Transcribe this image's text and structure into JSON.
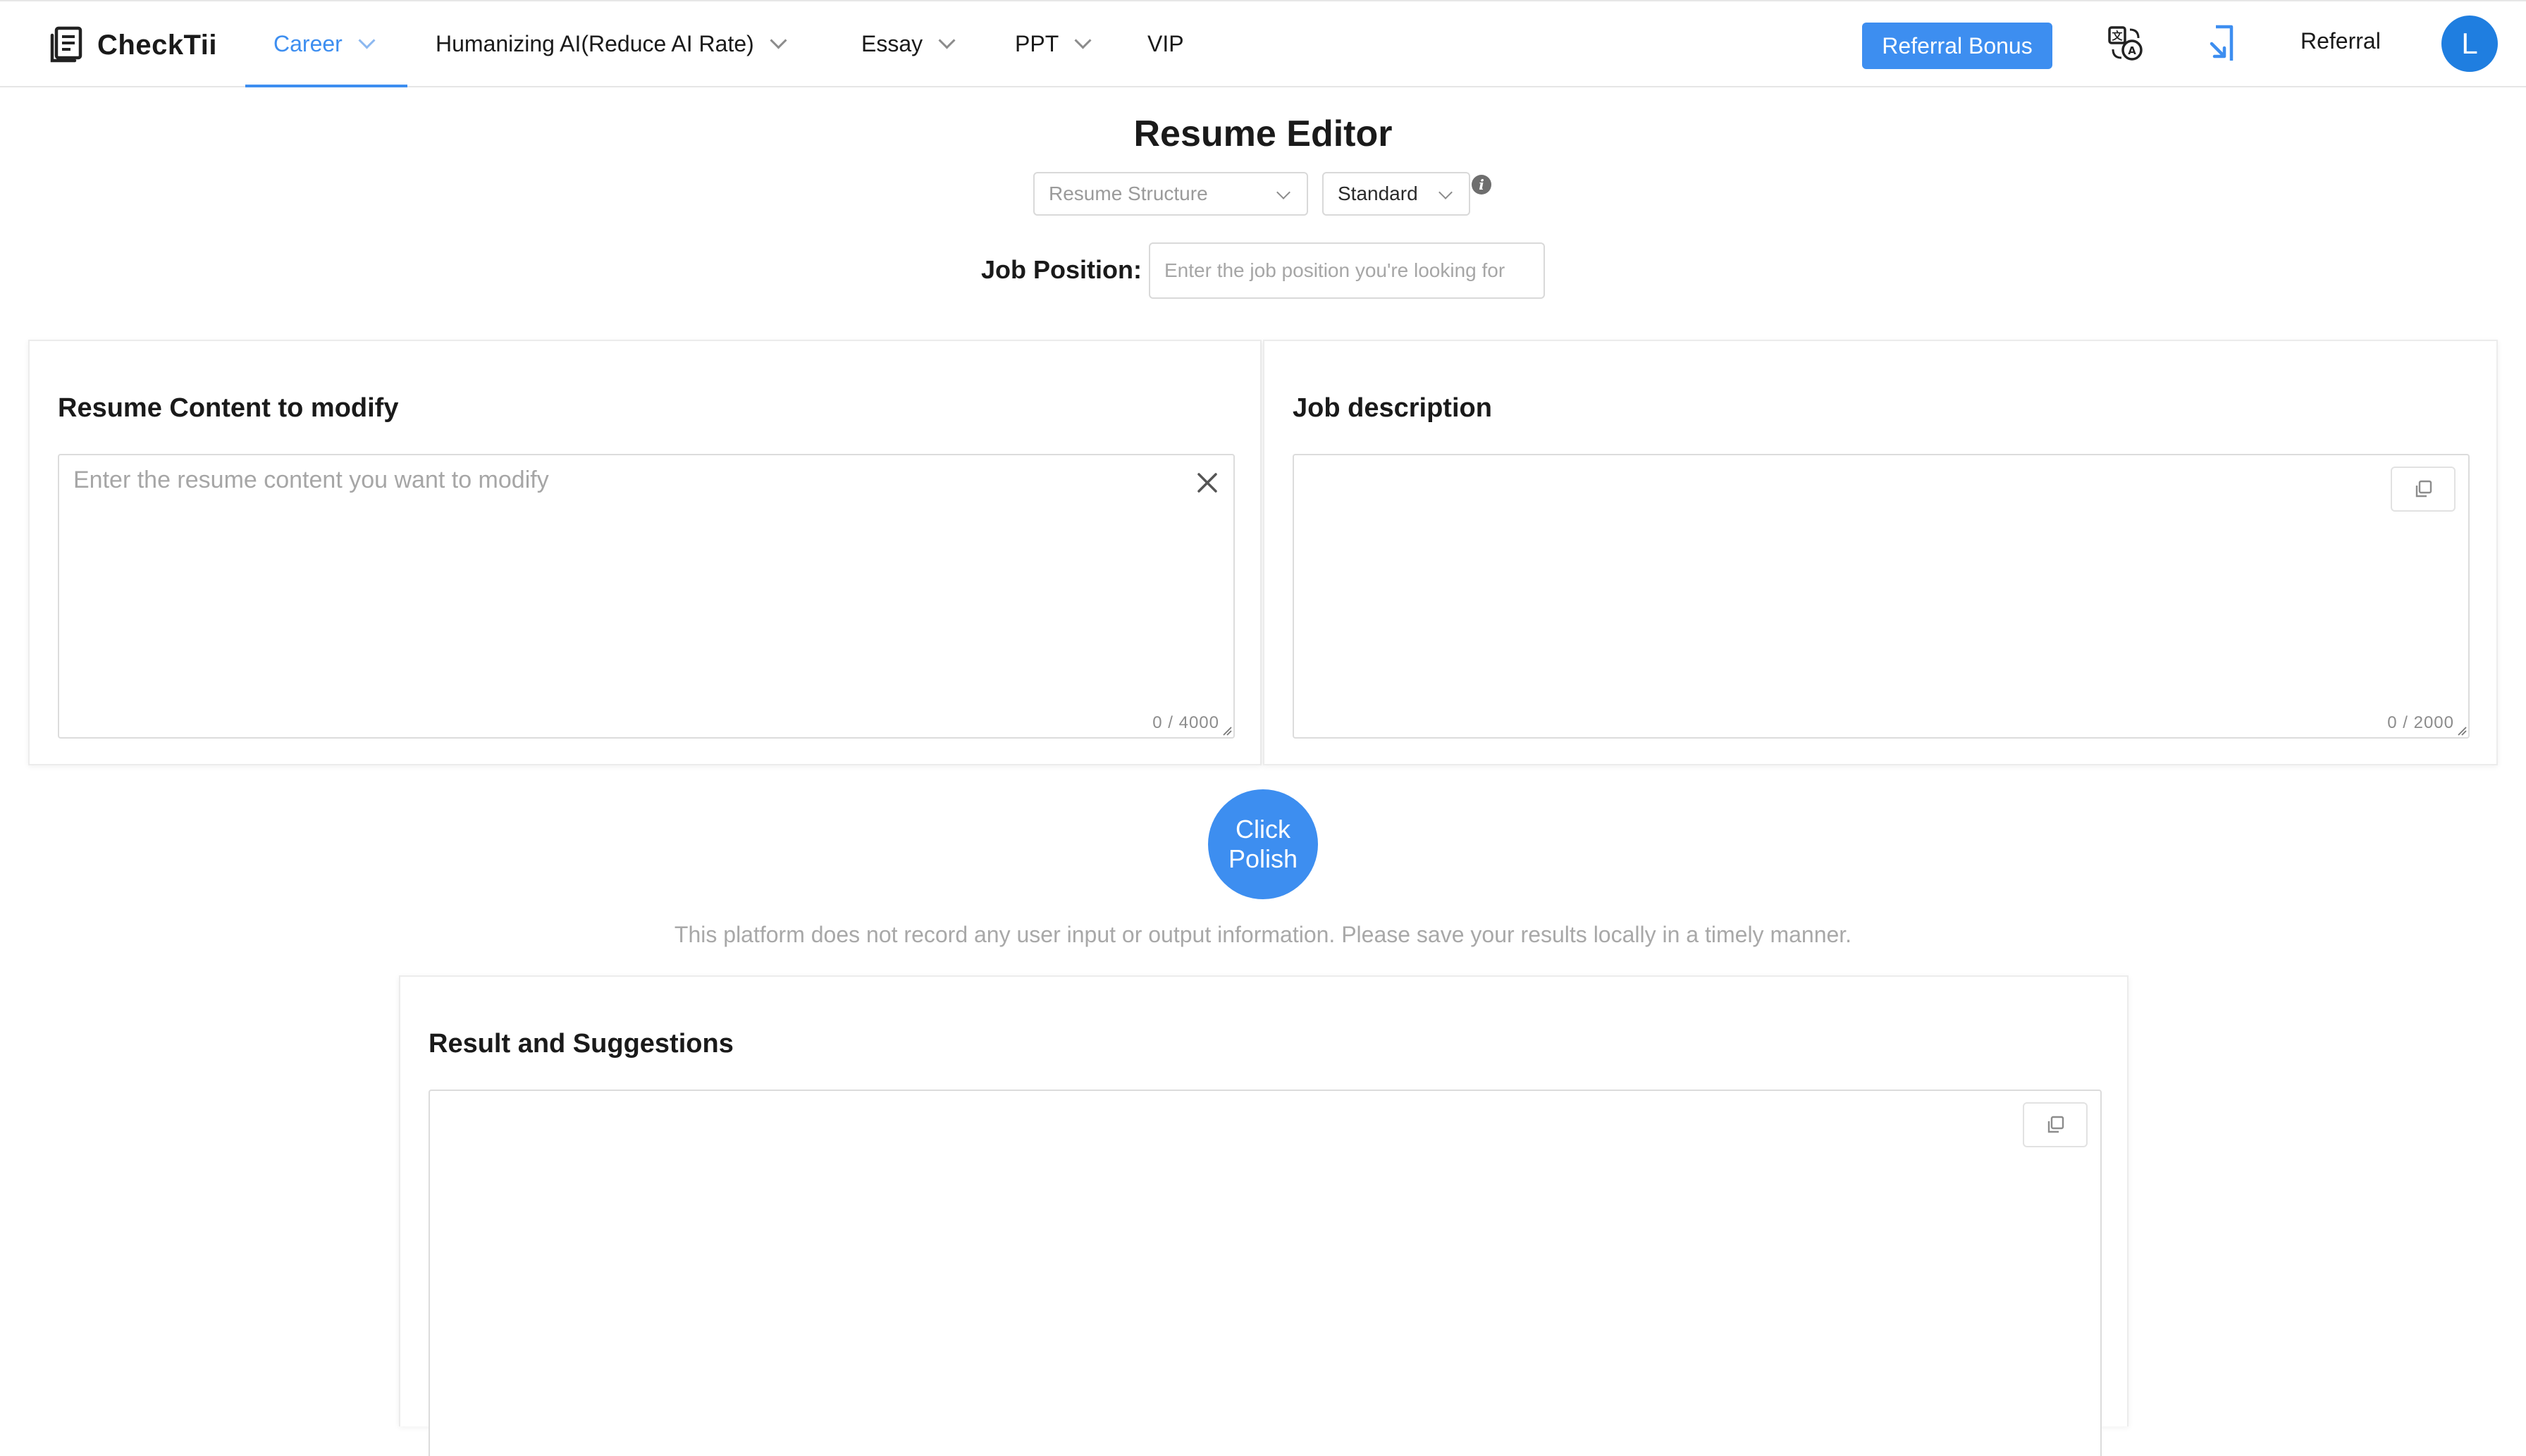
{
  "brand": {
    "name": "CheckTii"
  },
  "nav": {
    "items": [
      {
        "label": "Career",
        "active": true,
        "dropdown": true
      },
      {
        "label": "Humanizing AI(Reduce AI Rate)",
        "active": false,
        "dropdown": true
      },
      {
        "label": "Essay",
        "active": false,
        "dropdown": true
      },
      {
        "label": "PPT",
        "active": false,
        "dropdown": true
      },
      {
        "label": "VIP",
        "active": false,
        "dropdown": false
      }
    ]
  },
  "header": {
    "referral_bonus": "Referral Bonus",
    "referral": "Referral",
    "avatar_initial": "L",
    "icons": [
      "translate-icon",
      "share-exit-icon"
    ]
  },
  "editor": {
    "title": "Resume Editor",
    "structure_select": "Resume Structure",
    "style_select": "Standard",
    "job_label": "Job Position:",
    "job_placeholder": "Enter the job position you're looking for"
  },
  "resume_card": {
    "title": "Resume Content to modify",
    "placeholder": "Enter the resume content you want to modify",
    "counter": "0 / 4000"
  },
  "jd_card": {
    "title": "Job description",
    "counter": "0 / 2000"
  },
  "polish": {
    "line1": "Click",
    "line2": "Polish"
  },
  "disclaimer": "This platform does not record any user input or output information. Please save your results locally in a timely manner.",
  "result_card": {
    "title": "Result and Suggestions"
  },
  "colors": {
    "accent": "#3d8ef0",
    "avatar": "#1f7ee0"
  }
}
